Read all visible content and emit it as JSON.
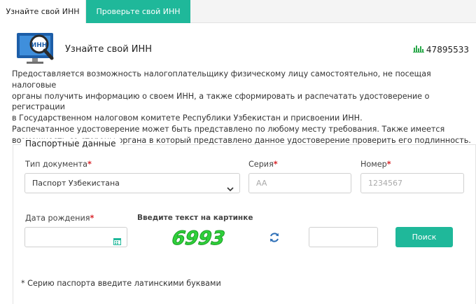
{
  "tabs": [
    {
      "label": "Узнайте свой ИНН"
    },
    {
      "label": "Проверьте свой ИНН"
    }
  ],
  "header": {
    "icon_text": "ИНН",
    "title": "Узнайте свой ИНН",
    "counter": "47895533"
  },
  "description": [
    "Предоставляется возможность налогоплательщику физическому лицу самостоятельно, не посещая налоговые",
    "органы получить информацию о своем ИНН, а также сформировать и распечатать удостоверение о регистрации",
    "в Государственном налоговом комитете Республики Узбекистан и присвоении ИНН.",
    "Распечатанное удостоверение может быть представлено по любому месту требования. Также имеется",
    "возможность со стороны органа в который представлено данное удостоверение проверить его подлинность."
  ],
  "form": {
    "legend": "Паспортные данные",
    "doc_type_label": "Тип документа",
    "doc_type_value": "Паспорт Узбекистана",
    "series_label": "Серия",
    "series_placeholder": "AA",
    "number_label": "Номер",
    "number_placeholder": "1234567",
    "birthdate_label": "Дата рождения",
    "captcha_label": "Введите текст на картинке",
    "captcha_text": "6993",
    "submit": "Поиск",
    "required_mark": "*",
    "note": "* Серию паспорта введите латинскими буквами"
  },
  "colors": {
    "accent": "#1fb89a",
    "required": "#d9262b",
    "counter_icon": "#2aa84a",
    "captcha_text": "#2fd13a",
    "refresh_icon": "#2d6fb7"
  },
  "icons": {
    "monitor": "monitor-magnifier-icon",
    "counter": "bar-chart-icon",
    "select": "chevron-down-icon",
    "date": "calendar-icon",
    "refresh": "refresh-icon"
  }
}
